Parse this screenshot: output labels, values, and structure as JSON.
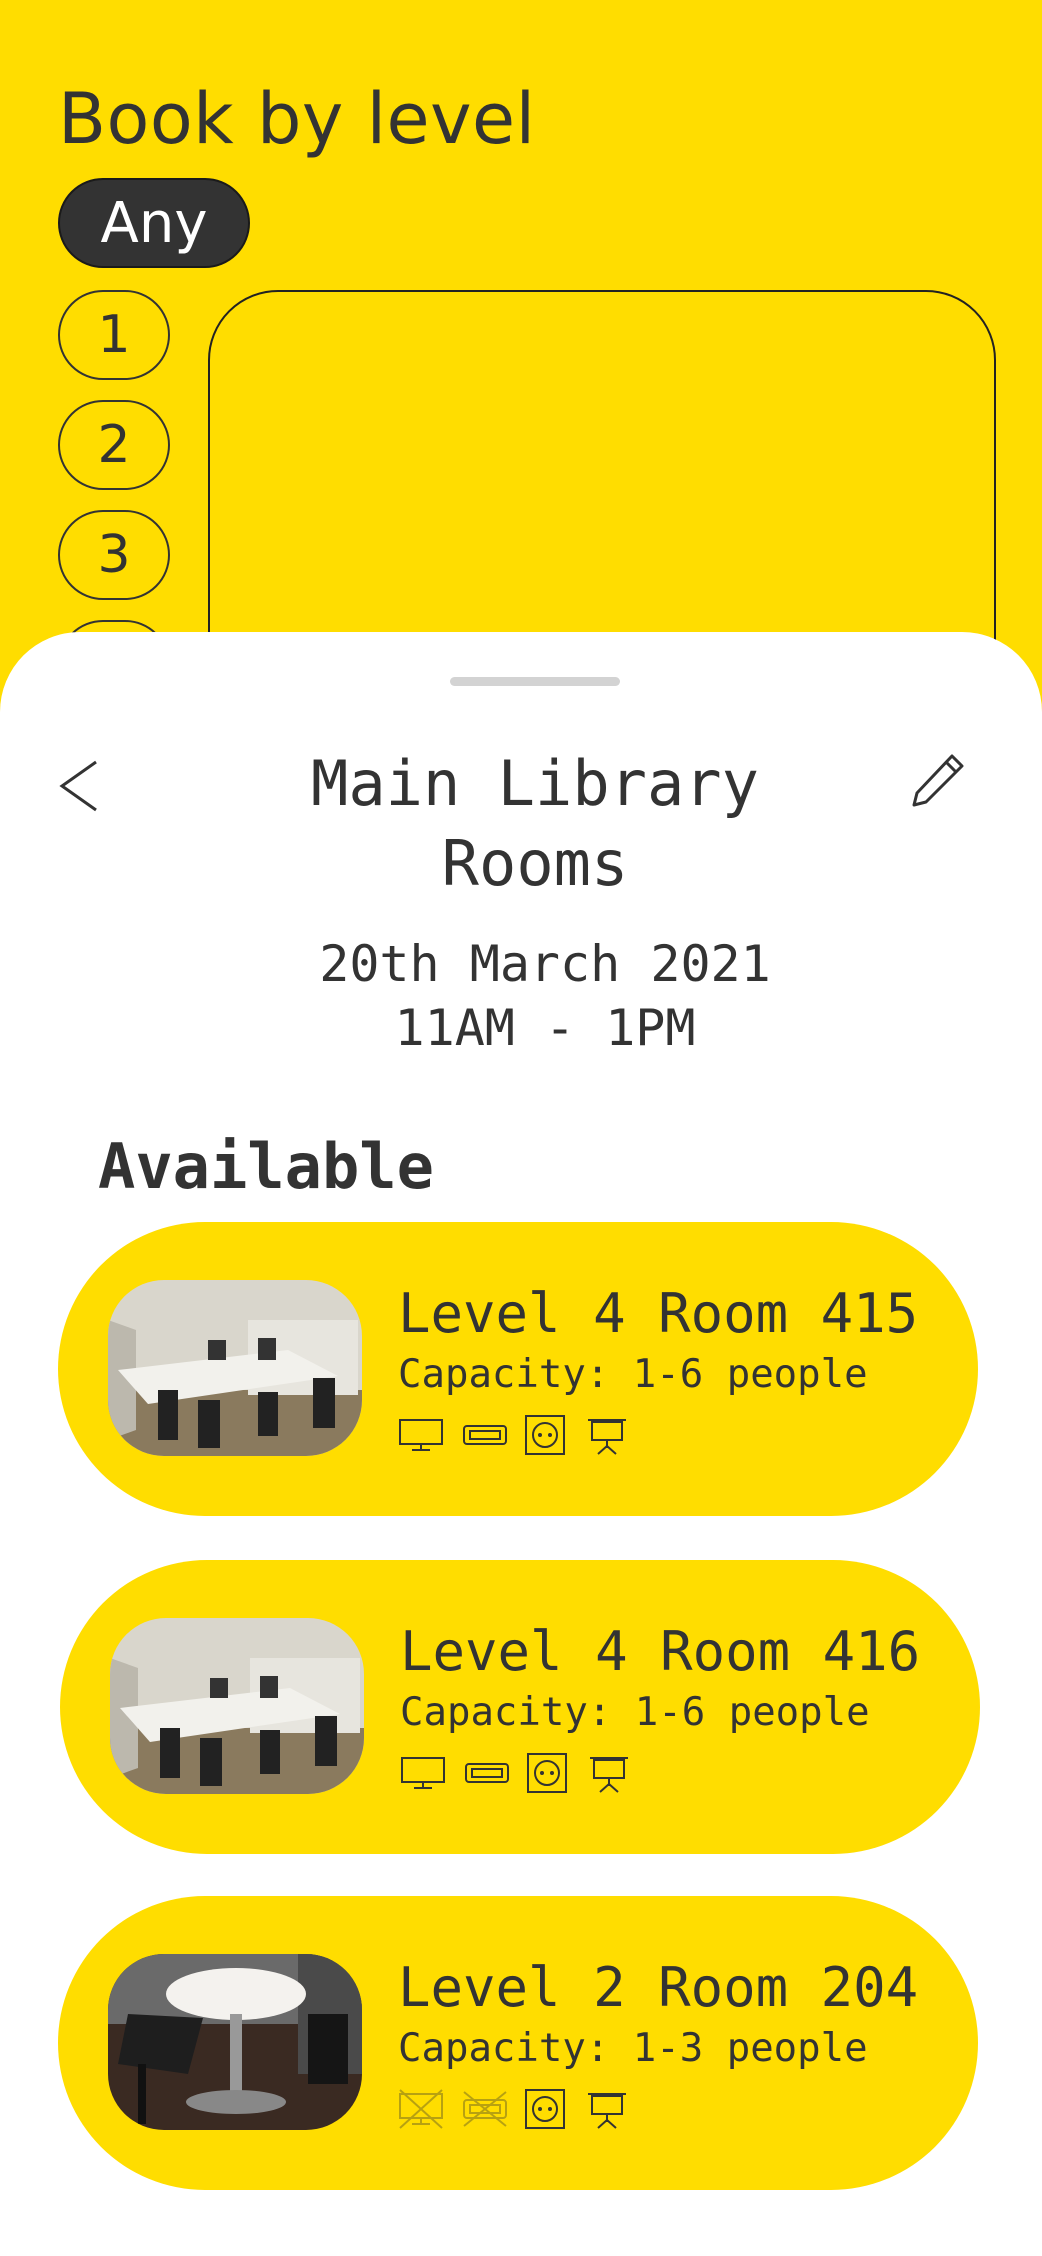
{
  "header": {
    "title": "Book by level"
  },
  "levels": {
    "any_label": "Any",
    "items": [
      "1",
      "2",
      "3"
    ]
  },
  "sheet": {
    "title_line1": "Main Library",
    "title_line2": "Rooms",
    "date": "20th March 2021",
    "time": "11AM - 1PM",
    "back_icon": "chevron-left-icon",
    "edit_icon": "pencil-icon",
    "section_label": "Available"
  },
  "rooms": [
    {
      "name": "Level 4 Room 415",
      "capacity": "Capacity: 1-6 people",
      "amenities": {
        "display": true,
        "hdmi": true,
        "power": true,
        "projector": true
      }
    },
    {
      "name": "Level 4 Room 416",
      "capacity": "Capacity: 1-6 people",
      "amenities": {
        "display": true,
        "hdmi": true,
        "power": true,
        "projector": true
      }
    },
    {
      "name": "Level 2 Room 204",
      "capacity": "Capacity: 1-3 people",
      "amenities": {
        "display": false,
        "hdmi": false,
        "power": true,
        "projector": true
      }
    }
  ],
  "colors": {
    "accent": "#FFDD00",
    "dark": "#333333",
    "sheet": "#FFFFFF"
  }
}
